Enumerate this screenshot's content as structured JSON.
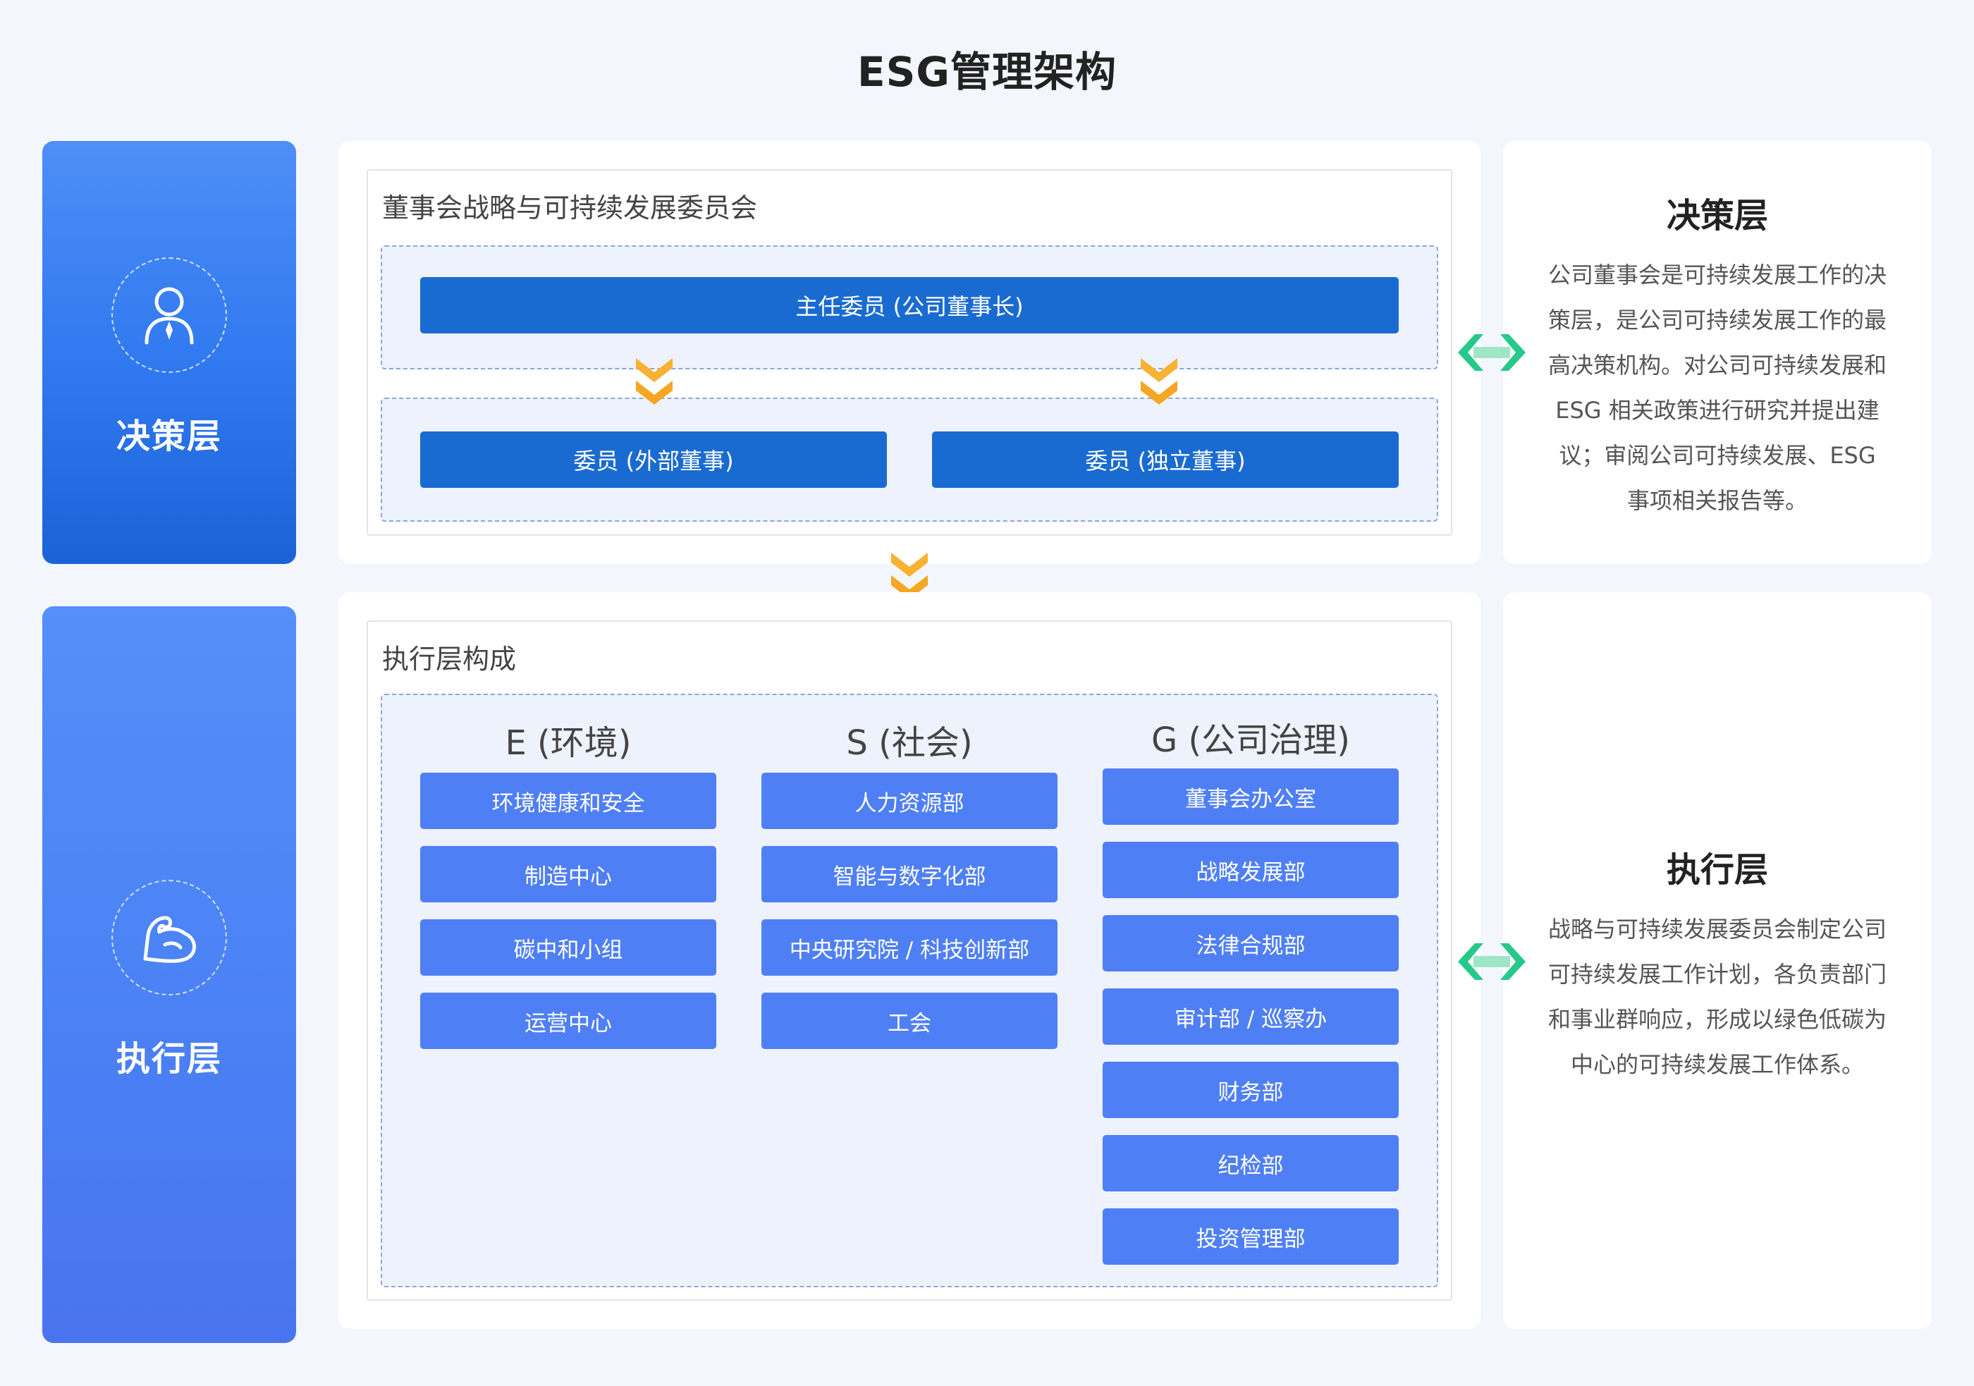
{
  "page": {
    "title": "ESG管理架构"
  },
  "decision": {
    "band_label": "决策层",
    "band_icon": "person-tie-icon",
    "committee_title": "董事会战略与可持续发展委员会",
    "chair": "主任委员 (公司董事长)",
    "members": [
      "委员 (外部董事)",
      "委员 (独立董事)"
    ],
    "desc_title": "决策层",
    "desc_lines": [
      "公司董事会是可持续发展工作的决",
      "策层，是公司可持续发展工作的最",
      "高决策机构。对公司可持续发展和",
      "ESG 相关政策进行研究并提出建",
      "议；审阅公司可持续发展、ESG",
      "事项相关报告等。"
    ]
  },
  "execution": {
    "band_label": "执行层",
    "band_icon": "flexed-arm-icon",
    "box_title": "执行层构成",
    "columns": [
      {
        "head": "E (环境)",
        "items": [
          "环境健康和安全",
          "制造中心",
          "碳中和小组",
          "运营中心"
        ]
      },
      {
        "head": "S (社会)",
        "items": [
          "人力资源部",
          "智能与数字化部",
          "中央研究院 / 科技创新部",
          "工会"
        ]
      },
      {
        "head": "G (公司治理)",
        "items": [
          "董事会办公室",
          "战略发展部",
          "法律合规部",
          "审计部 / 巡察办",
          "财务部",
          "纪检部",
          "投资管理部"
        ]
      }
    ],
    "desc_title": "执行层",
    "desc_lines": [
      "战略与可持续发展委员会制定公司",
      "可持续发展工作计划，各负责部门",
      "和事业群响应，形成以绿色低碳为",
      "中心的可持续发展工作体系。"
    ]
  },
  "colors": {
    "page_bg": "#f3f6fc",
    "decision_band": "#2f78ef",
    "exec_band": "#4f7ff5",
    "dark_button": "#1a6bd1",
    "blue_button": "#4f7ff5",
    "chevron": "#f5a623",
    "double_arrow": "#27c98a"
  },
  "icons": [
    "chevron-double-down-icon",
    "double-arrow-icon"
  ]
}
